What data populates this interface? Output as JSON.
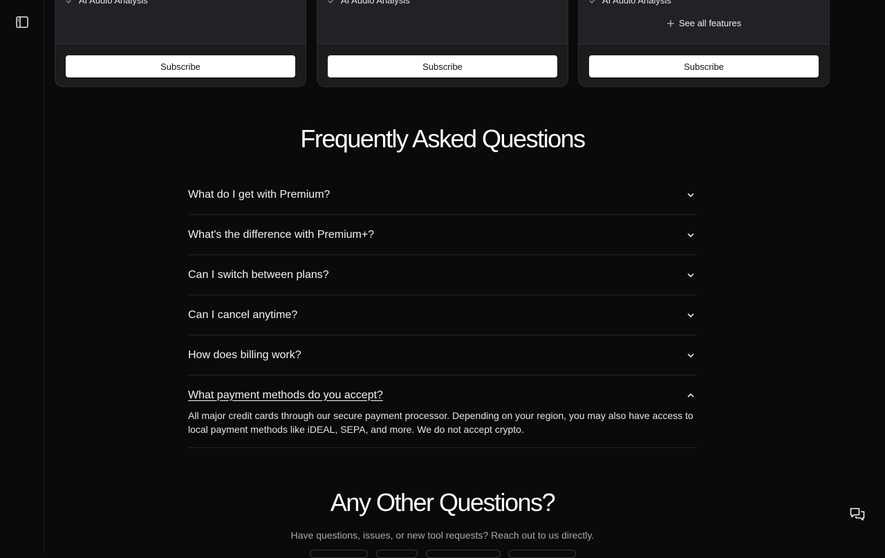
{
  "sidebar": {
    "toggle_icon": "sidebar-panel-icon"
  },
  "pricing_cards": [
    {
      "feature": "AI Audio Analysis",
      "see_all": "",
      "subscribe": "Subscribe"
    },
    {
      "feature": "AI Audio Analysis",
      "see_all": "",
      "subscribe": "Subscribe"
    },
    {
      "feature": "AI Audio Analysis",
      "see_all": "See all features",
      "subscribe": "Subscribe"
    }
  ],
  "faq": {
    "title": "Frequently Asked Questions",
    "items": [
      {
        "question": "What do I get with Premium?",
        "open": false
      },
      {
        "question": "What's the difference with Premium+?",
        "open": false
      },
      {
        "question": "Can I switch between plans?",
        "open": false
      },
      {
        "question": "Can I cancel anytime?",
        "open": false
      },
      {
        "question": "How does billing work?",
        "open": false
      },
      {
        "question": "What payment methods do you accept?",
        "open": true,
        "answer": "All major credit cards through our secure payment processor. Depending on your region, you may also have access to local payment methods like iDEAL, SEPA, and more. We do not accept crypto."
      }
    ]
  },
  "other_questions": {
    "title": "Any Other Questions?",
    "subtitle": "Have questions, issues, or new tool requests? Reach out to us directly."
  },
  "colors": {
    "background": "#0a0a0b",
    "card": "#1c1c1f",
    "button": "#ffffff"
  }
}
